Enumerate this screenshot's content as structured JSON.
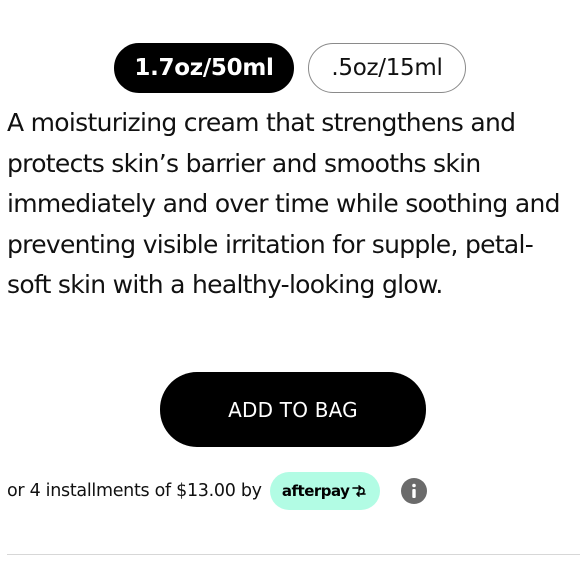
{
  "sizes": {
    "options": [
      {
        "label": "1.7oz/50ml",
        "selected": true
      },
      {
        "label": ".5oz/15ml",
        "selected": false
      }
    ]
  },
  "product": {
    "description": "A moisturizing cream that strengthens and protects skin’s barrier and smooths skin immediately and over time while soothing and preventing visible irritation for supple, petal-soft skin with a healthy-looking glow."
  },
  "cart": {
    "add_label": "ADD TO BAG"
  },
  "payment": {
    "installments_text": "or 4 installments of $13.00 by",
    "provider_label": "afterpay",
    "provider_icon": "afterpay-arrows-icon",
    "info_icon": "info-icon",
    "colors": {
      "badge": "#b2fce4",
      "info": "#6b6b6b"
    }
  },
  "colors": {
    "primary": "#000000",
    "background": "#ffffff",
    "divider": "#d7d7d7"
  }
}
